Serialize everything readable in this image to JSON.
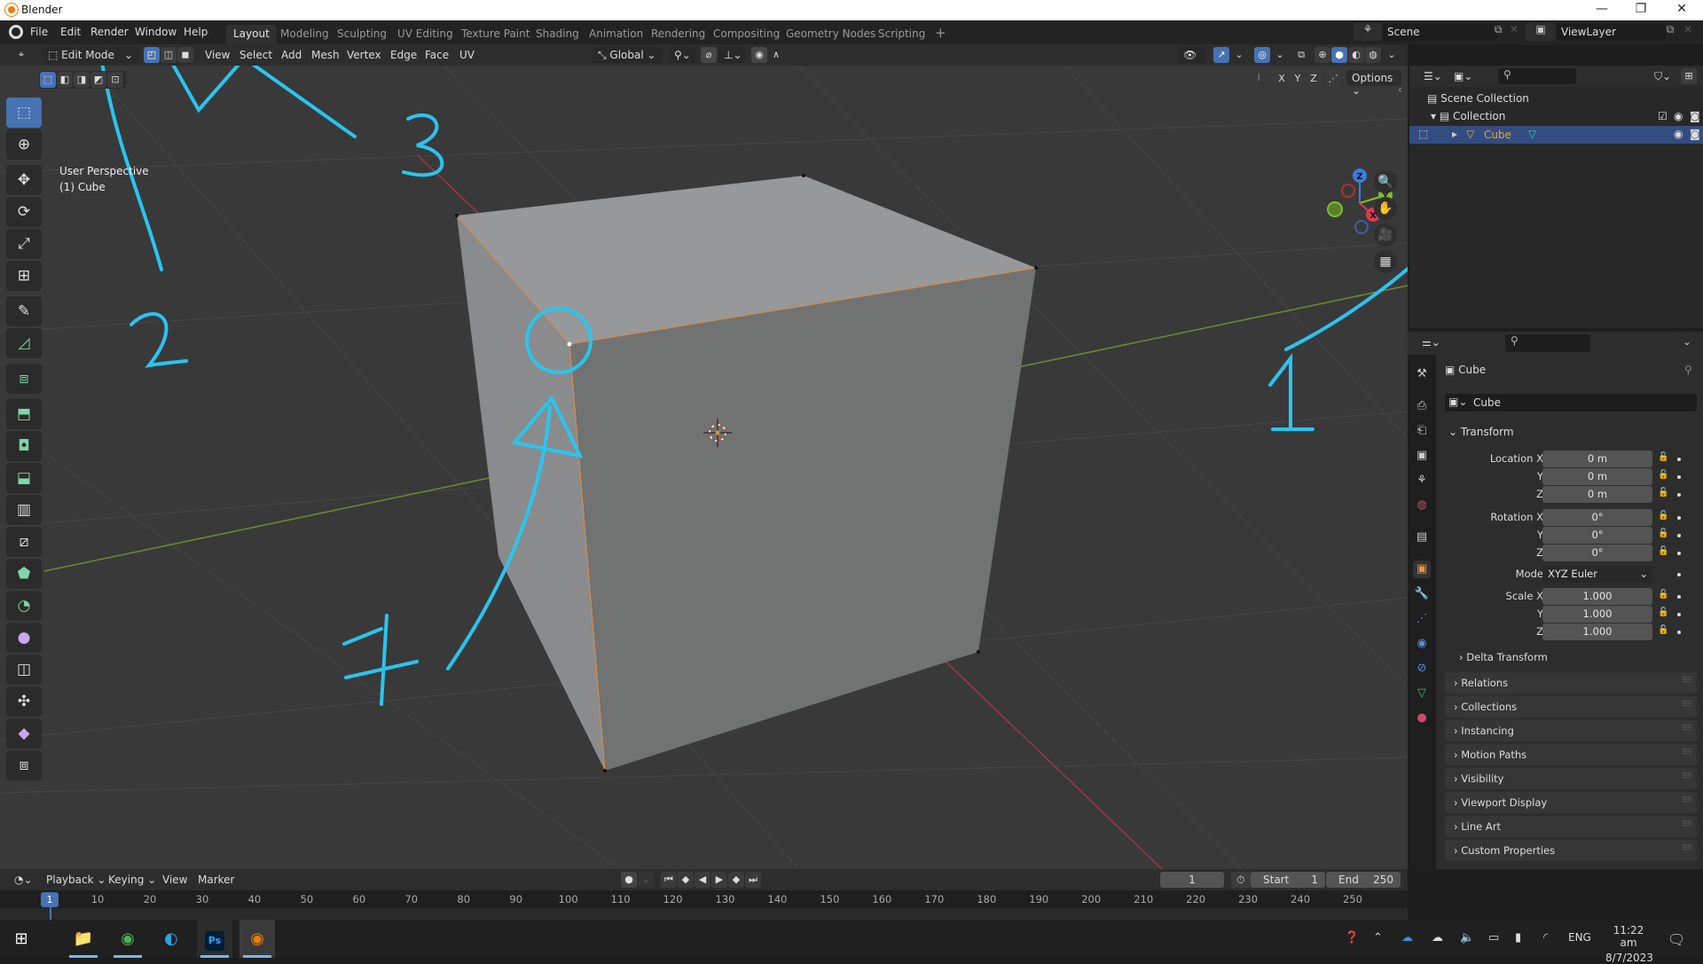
{
  "window": {
    "title": "Blender",
    "minimize": "—",
    "maximize": "❐",
    "close": "✕"
  },
  "menubar": {
    "menus": [
      "File",
      "Edit",
      "Render",
      "Window",
      "Help"
    ],
    "workspaces": [
      "Layout",
      "Modeling",
      "Sculpting",
      "UV Editing",
      "Texture Paint",
      "Shading",
      "Animation",
      "Rendering",
      "Compositing",
      "Geometry Nodes",
      "Scripting"
    ],
    "active_workspace": "Layout",
    "add_workspace": "+",
    "scene": "Scene",
    "view_layer": "ViewLayer"
  },
  "viewport_header": {
    "mode": "Edit Mode",
    "select_modes": [
      "vertex",
      "edge",
      "face"
    ],
    "active_select_mode": "vertex",
    "menus": [
      "View",
      "Select",
      "Add",
      "Mesh",
      "Vertex",
      "Edge",
      "Face",
      "UV"
    ],
    "orientation": "Global",
    "options_label": "Options",
    "axes": [
      "X",
      "Y",
      "Z"
    ]
  },
  "viewport": {
    "view_name": "User Perspective",
    "object_label": "(1) Cube",
    "gizmo_axes": {
      "x": "X",
      "y": "Y",
      "z": "Z"
    },
    "tools": [
      "select-box",
      "cursor",
      "move",
      "rotate",
      "scale",
      "transform",
      "annotate",
      "measure",
      "add-cube",
      "extrude-region",
      "inset-faces",
      "bevel",
      "loop-cut",
      "knife",
      "poly-build",
      "spin",
      "smooth",
      "edge-slide",
      "shrink-fatten",
      "shear",
      "rip-region"
    ],
    "annotations": [
      "1",
      "2",
      "3",
      "4"
    ],
    "annotation_color": "#29c5f0"
  },
  "outliner": {
    "root": "Scene Collection",
    "collection": "Collection",
    "object": "Cube"
  },
  "properties": {
    "object_name": "Cube",
    "datablock_name": "Cube",
    "transform_title": "Transform",
    "location": {
      "label": "Location X",
      "x": "0 m",
      "y": "0 m",
      "z": "0 m"
    },
    "rotation": {
      "label": "Rotation X",
      "x": "0°",
      "y": "0°",
      "z": "0°"
    },
    "mode_label": "Mode",
    "mode_value": "XYZ Euler",
    "scale": {
      "label": "Scale X",
      "x": "1.000",
      "y": "1.000",
      "z": "1.000"
    },
    "axis_y": "Y",
    "axis_z": "Z",
    "delta_transform": "Delta Transform",
    "panels": [
      "Relations",
      "Collections",
      "Instancing",
      "Motion Paths",
      "Visibility",
      "Viewport Display",
      "Line Art",
      "Custom Properties"
    ]
  },
  "timeline": {
    "menus": [
      "Playback",
      "Keying",
      "View",
      "Marker"
    ],
    "current_frame": "1",
    "start_label": "Start",
    "start": "1",
    "end_label": "End",
    "end": "250",
    "ticks": [
      "1",
      "10",
      "20",
      "30",
      "40",
      "50",
      "60",
      "70",
      "80",
      "90",
      "100",
      "110",
      "120",
      "130",
      "140",
      "150",
      "160",
      "170",
      "180",
      "190",
      "200",
      "210",
      "220",
      "230",
      "240",
      "250"
    ]
  },
  "taskbar": {
    "apps": [
      "start",
      "file-explorer",
      "chrome",
      "edge",
      "photoshop",
      "blender"
    ],
    "lang": "ENG",
    "time": "11:22 am",
    "date": "8/7/2023",
    "ps_label": "Ps"
  }
}
